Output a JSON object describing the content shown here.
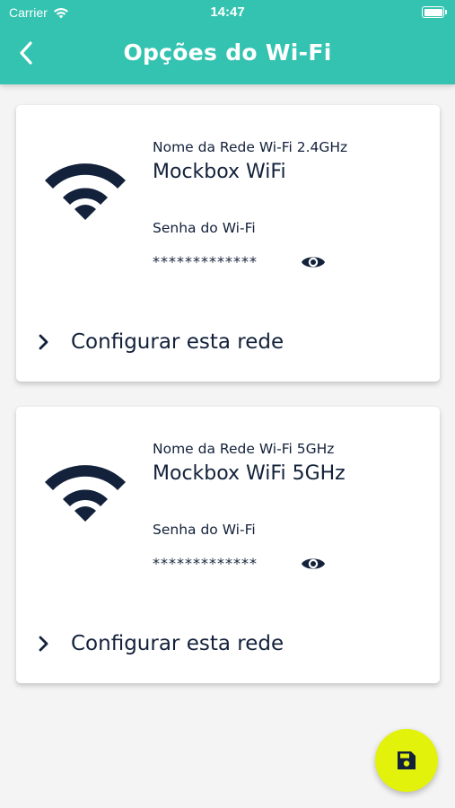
{
  "status_bar": {
    "carrier": "Carrier",
    "time": "14:47",
    "icons": [
      "wifi-signal-icon",
      "battery-icon"
    ]
  },
  "header": {
    "title": "Opções do Wi-Fi",
    "back_icon": "chevron-left-icon",
    "background_color": "#34c3b0"
  },
  "networks": [
    {
      "label": "Nome da Rede Wi-Fi 2.4GHz",
      "name": "Mockbox WiFi",
      "password_label": "Senha do Wi-Fi",
      "password_masked": "*************",
      "icon": "wifi-icon",
      "toggle_icon": "eye-icon",
      "action_label": "Configurar esta rede"
    },
    {
      "label": "Nome da Rede Wi-Fi 5GHz",
      "name": "Mockbox WiFi 5GHz",
      "password_label": "Senha do Wi-Fi",
      "password_masked": "*************",
      "icon": "wifi-icon",
      "toggle_icon": "eye-icon",
      "action_label": "Configurar esta rede"
    }
  ],
  "fab": {
    "icon": "save-icon",
    "color": "#e2f20a"
  },
  "colors": {
    "text": "#13213a",
    "background": "#f4f4f4"
  }
}
